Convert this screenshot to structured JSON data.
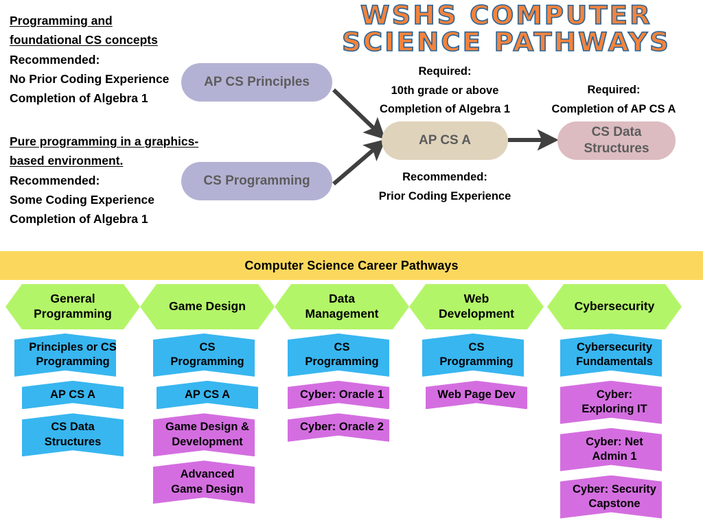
{
  "title": {
    "line1": "WSHS COMPUTER",
    "line2": "SCIENCE PATHWAYS"
  },
  "colors": {
    "title_fill": "#F4833C",
    "title_outline": "#2A6496",
    "pill_purple": "#B4B2D4",
    "pill_tan": "#E0D3BC",
    "pill_pink": "#DCBCC0",
    "banner_yellow": "#FBD85D",
    "hex_green": "#B3F568",
    "hex_blue": "#38B6F0",
    "hex_magenta": "#D46EE0",
    "arrow_gray": "#404040",
    "pill_text": "#5C5C5C"
  },
  "descriptions": [
    {
      "heading_line1": "Programming and",
      "heading_line2": "foundational CS concepts",
      "body": [
        "Recommended:",
        "No Prior Coding Experience",
        "Completion of Algebra 1"
      ]
    },
    {
      "heading_line1": "Pure programming in a graphics-",
      "heading_line2": "based environment.",
      "body": [
        "Recommended:",
        "Some Coding Experience",
        "Completion of Algebra 1"
      ]
    }
  ],
  "courses": {
    "ap_cs_principles": "AP CS Principles",
    "cs_programming": "CS Programming",
    "ap_cs_a": "AP CS A",
    "cs_data_structures": "CS Data\nStructures"
  },
  "notes": {
    "apcsa_required": [
      "Required:",
      "10th grade or above",
      "Completion of Algebra 1"
    ],
    "apcsa_recommended": [
      "Recommended:",
      "Prior Coding Experience"
    ],
    "datastructures_required": [
      "Required:",
      "Completion of AP CS A"
    ]
  },
  "banner": {
    "label": "Computer Science Career Pathways"
  },
  "pathways": [
    {
      "name": "General\nProgramming",
      "courses": [
        {
          "label": "Principles or CS\nProgramming",
          "type": "blue",
          "width": "w170"
        },
        {
          "label": "AP CS A",
          "type": "blue",
          "width": "w148"
        },
        {
          "label": "CS Data\nStructures",
          "type": "blue",
          "width": "w148"
        }
      ]
    },
    {
      "name": "Game Design",
      "courses": [
        {
          "label": "CS\nProgramming",
          "type": "blue",
          "width": "w158"
        },
        {
          "label": "AP CS A",
          "type": "blue",
          "width": "w148"
        },
        {
          "label": "Game Design &\nDevelopment",
          "type": "magenta",
          "width": "w158"
        },
        {
          "label": "Advanced\nGame Design",
          "type": "magenta",
          "width": "w158"
        }
      ]
    },
    {
      "name": "Data\nManagement",
      "courses": [
        {
          "label": "CS\nProgramming",
          "type": "blue",
          "width": "w158"
        },
        {
          "label": "Cyber: Oracle 1",
          "type": "magenta",
          "width": "w158"
        },
        {
          "label": "Cyber: Oracle 2",
          "type": "magenta",
          "width": "w158"
        }
      ]
    },
    {
      "name": "Web\nDevelopment",
      "courses": [
        {
          "label": "CS\nProgramming",
          "type": "blue",
          "width": "w158"
        },
        {
          "label": "Web Page Dev",
          "type": "magenta",
          "width": "w148"
        }
      ]
    },
    {
      "name": "Cybersecurity",
      "courses": [
        {
          "label": "Cybersecurity\nFundamentals",
          "type": "blue",
          "width": "w158"
        },
        {
          "label": "Cyber:\nExploring IT",
          "type": "magenta",
          "width": "w158"
        },
        {
          "label": "Cyber: Net\nAdmin 1",
          "type": "magenta",
          "width": "w158"
        },
        {
          "label": "Cyber: Security\nCapstone",
          "type": "magenta",
          "width": "w158"
        }
      ]
    }
  ]
}
